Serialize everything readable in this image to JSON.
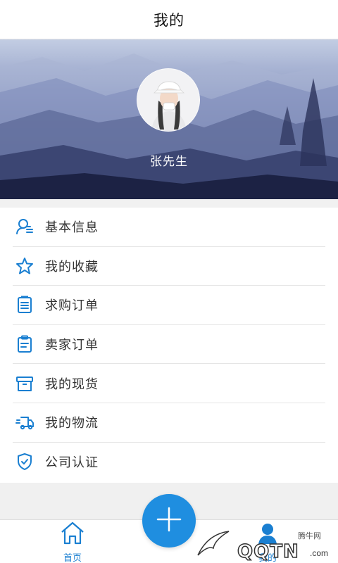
{
  "header": {
    "title": "我的"
  },
  "profile": {
    "name": "张先生"
  },
  "menu": {
    "items": [
      {
        "label": "基本信息",
        "icon": "user-info-icon"
      },
      {
        "label": "我的收藏",
        "icon": "star-icon"
      },
      {
        "label": "求购订单",
        "icon": "clipboard-list-icon"
      },
      {
        "label": "卖家订单",
        "icon": "clipboard-icon"
      },
      {
        "label": "我的现货",
        "icon": "archive-box-icon"
      },
      {
        "label": "我的物流",
        "icon": "truck-icon"
      },
      {
        "label": "公司认证",
        "icon": "shield-check-icon"
      }
    ]
  },
  "tabbar": {
    "home_label": "首页",
    "me_label": "我的",
    "add_icon": "plus-icon"
  },
  "watermark": {
    "cn": "腾牛网",
    "logo": "QQTN",
    "suffix": ".com"
  },
  "colors": {
    "accent": "#1f8ee0",
    "icon": "#1a7fd1"
  }
}
